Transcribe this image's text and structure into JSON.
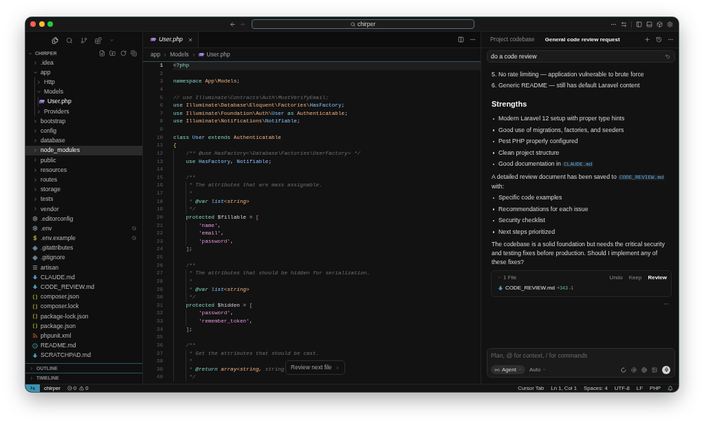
{
  "title_bar": {
    "nav": [
      {
        "kind": "back",
        "disabled": false
      },
      {
        "kind": "forward",
        "disabled": true
      }
    ],
    "command_center": "chirper"
  },
  "activity_bar": [
    {
      "kind": "explorer",
      "selected": true
    },
    {
      "kind": "search",
      "selected": false
    },
    {
      "kind": "source_control",
      "selected": false
    },
    {
      "kind": "extensions",
      "selected": false
    }
  ],
  "explorer": {
    "title": "CHIRPER",
    "expanded": true,
    "tree": [
      {
        "name": ".idea",
        "kind": "folder",
        "expanded": false,
        "selected": false,
        "active": false,
        "ignored": false
      },
      {
        "name": "app",
        "kind": "folder",
        "expanded": true,
        "selected": false,
        "active": false,
        "ignored": false,
        "children": [
          {
            "name": "Http",
            "kind": "folder",
            "expanded": false,
            "selected": false,
            "active": false,
            "ignored": false
          },
          {
            "name": "Models",
            "kind": "folder",
            "expanded": true,
            "selected": false,
            "active": false,
            "ignored": false,
            "children": [
              {
                "name": "User.php",
                "kind": "php",
                "selected": false,
                "active": true,
                "ignored": false
              }
            ]
          },
          {
            "name": "Providers",
            "kind": "folder",
            "expanded": false,
            "selected": false,
            "active": false,
            "ignored": false
          }
        ]
      },
      {
        "name": "bootstrap",
        "kind": "folder",
        "expanded": false,
        "selected": false,
        "active": false,
        "ignored": false
      },
      {
        "name": "config",
        "kind": "folder",
        "expanded": false,
        "selected": false,
        "active": false,
        "ignored": false
      },
      {
        "name": "database",
        "kind": "folder",
        "expanded": false,
        "selected": false,
        "active": false,
        "ignored": false
      },
      {
        "name": "node_modules",
        "kind": "folder",
        "expanded": false,
        "selected": true,
        "active": false,
        "ignored": false
      },
      {
        "name": "public",
        "kind": "folder",
        "expanded": false,
        "selected": false,
        "active": false,
        "ignored": false
      },
      {
        "name": "resources",
        "kind": "folder",
        "expanded": false,
        "selected": false,
        "active": false,
        "ignored": false
      },
      {
        "name": "routes",
        "kind": "folder",
        "expanded": false,
        "selected": false,
        "active": false,
        "ignored": false
      },
      {
        "name": "storage",
        "kind": "folder",
        "expanded": false,
        "selected": false,
        "active": false,
        "ignored": false
      },
      {
        "name": "tests",
        "kind": "folder",
        "expanded": false,
        "selected": false,
        "active": false,
        "ignored": false
      },
      {
        "name": "vendor",
        "kind": "folder",
        "expanded": false,
        "selected": false,
        "active": false,
        "ignored": false
      },
      {
        "name": ".editorconfig",
        "kind": "settings",
        "selected": false,
        "active": false,
        "ignored": false
      },
      {
        "name": ".env",
        "kind": "settings",
        "selected": false,
        "active": false,
        "ignored": true
      },
      {
        "name": ".env.example",
        "kind": "env",
        "selected": false,
        "active": false,
        "ignored": true
      },
      {
        "name": ".gitattributes",
        "kind": "git",
        "selected": false,
        "active": false,
        "ignored": false
      },
      {
        "name": ".gitignore",
        "kind": "git",
        "selected": false,
        "active": false,
        "ignored": false
      },
      {
        "name": "artisan",
        "kind": "text",
        "selected": false,
        "active": false,
        "ignored": false
      },
      {
        "name": "CLAUDE.md",
        "kind": "markdown",
        "selected": false,
        "active": false,
        "ignored": false
      },
      {
        "name": "CODE_REVIEW.md",
        "kind": "markdown",
        "selected": false,
        "active": false,
        "ignored": false
      },
      {
        "name": "composer.json",
        "kind": "json",
        "selected": false,
        "active": false,
        "ignored": false
      },
      {
        "name": "composer.lock",
        "kind": "json",
        "selected": false,
        "active": false,
        "ignored": false
      },
      {
        "name": "package-lock.json",
        "kind": "json",
        "selected": false,
        "active": false,
        "ignored": false
      },
      {
        "name": "package.json",
        "kind": "json",
        "selected": false,
        "active": false,
        "ignored": false
      },
      {
        "name": "phpunit.xml",
        "kind": "xml",
        "selected": false,
        "active": false,
        "ignored": false
      },
      {
        "name": "README.md",
        "kind": "info",
        "selected": false,
        "active": false,
        "ignored": false
      },
      {
        "name": "SCRATCHPAD.md",
        "kind": "markdown",
        "selected": false,
        "active": false,
        "ignored": false
      }
    ]
  },
  "sidebar_sections": [
    {
      "title": "OUTLINE",
      "expanded": false
    },
    {
      "title": "TIMELINE",
      "expanded": false
    }
  ],
  "editor": {
    "tabs": [
      {
        "label": "User.php",
        "kind": "php",
        "preview": true,
        "selected": true
      }
    ],
    "breadcrumbs": [
      {
        "label": "app",
        "kind": "folder"
      },
      {
        "label": "Models",
        "kind": "folder"
      },
      {
        "label": "User.php",
        "kind": "php"
      }
    ],
    "lines": [
      {
        "number": "1",
        "current": true,
        "tokens": [
          {
            "kind": "tag",
            "text": "<?php"
          }
        ]
      },
      {
        "number": "2",
        "current": false
      },
      {
        "number": "3",
        "current": false,
        "tokens": [
          {
            "kind": "keyword",
            "text": "namespace "
          },
          {
            "kind": "namespace",
            "text": "App\\Models"
          },
          {
            "kind": "plain",
            "text": ";"
          }
        ]
      },
      {
        "number": "4",
        "current": false
      },
      {
        "number": "5",
        "current": false,
        "tokens": [
          {
            "kind": "comment",
            "text": "// use Illuminate\\Contracts\\Auth\\MustVerifyEmail;"
          }
        ]
      },
      {
        "number": "6",
        "current": false,
        "tokens": [
          {
            "kind": "keyword",
            "text": "use "
          },
          {
            "kind": "namespace",
            "text": "Illuminate\\Database\\Eloquent\\Factories\\"
          },
          {
            "kind": "type",
            "text": "HasFactory"
          },
          {
            "kind": "plain",
            "text": ";"
          }
        ]
      },
      {
        "number": "7",
        "current": false,
        "tokens": [
          {
            "kind": "keyword",
            "text": "use "
          },
          {
            "kind": "namespace",
            "text": "Illuminate\\Foundation\\Auth\\"
          },
          {
            "kind": "type",
            "text": "User"
          },
          {
            "kind": "keyword",
            "text": " as "
          },
          {
            "kind": "namespace",
            "text": "Authenticatable"
          },
          {
            "kind": "plain",
            "text": ";"
          }
        ]
      },
      {
        "number": "8",
        "current": false,
        "tokens": [
          {
            "kind": "keyword",
            "text": "use "
          },
          {
            "kind": "namespace",
            "text": "Illuminate\\Notifications\\"
          },
          {
            "kind": "type",
            "text": "Notifiable"
          },
          {
            "kind": "plain",
            "text": ";"
          }
        ]
      },
      {
        "number": "9",
        "current": false
      },
      {
        "number": "10",
        "current": false,
        "tokens": [
          {
            "kind": "keyword",
            "text": "class "
          },
          {
            "kind": "type",
            "text": "User"
          },
          {
            "kind": "keyword",
            "text": " extends "
          },
          {
            "kind": "namespace",
            "text": "Authenticatable"
          }
        ]
      },
      {
        "number": "11",
        "current": false,
        "tokens": [
          {
            "kind": "brace",
            "text": "{"
          }
        ]
      },
      {
        "number": "12",
        "current": false,
        "tokens": [
          {
            "kind": "comment",
            "text": "    /** @use HasFactory<\\Database\\Factories\\UserFactory> */"
          }
        ]
      },
      {
        "number": "13",
        "current": false,
        "tokens": [
          {
            "kind": "keyword",
            "text": "    use "
          },
          {
            "kind": "type",
            "text": "HasFactory"
          },
          {
            "kind": "plain",
            "text": ", "
          },
          {
            "kind": "type",
            "text": "Notifiable"
          },
          {
            "kind": "plain",
            "text": ";"
          }
        ]
      },
      {
        "number": "14",
        "current": false
      },
      {
        "number": "15",
        "current": false,
        "tokens": [
          {
            "kind": "comment",
            "text": "    /**"
          }
        ]
      },
      {
        "number": "16",
        "current": false,
        "tokens": [
          {
            "kind": "comment",
            "text": "     * The attributes that are mass assignable."
          }
        ]
      },
      {
        "number": "17",
        "current": false,
        "tokens": [
          {
            "kind": "comment",
            "text": "     *"
          }
        ]
      },
      {
        "number": "18",
        "current": false,
        "tokens": [
          {
            "kind": "comment",
            "text": "     * "
          },
          {
            "kind": "doctag",
            "text": "@var"
          },
          {
            "kind": "doctype",
            "text": " list"
          },
          {
            "kind": "docgeneric",
            "text": "<string>"
          }
        ]
      },
      {
        "number": "19",
        "current": false,
        "tokens": [
          {
            "kind": "comment",
            "text": "     */"
          }
        ]
      },
      {
        "number": "20",
        "current": false,
        "tokens": [
          {
            "kind": "keyword",
            "text": "    protected "
          },
          {
            "kind": "variable",
            "text": "$fillable = "
          },
          {
            "kind": "bracket",
            "text": "["
          }
        ]
      },
      {
        "number": "21",
        "current": false,
        "tokens": [
          {
            "kind": "string",
            "text": "        'name'"
          },
          {
            "kind": "plain",
            "text": ","
          }
        ]
      },
      {
        "number": "22",
        "current": false,
        "tokens": [
          {
            "kind": "string",
            "text": "        'email'"
          },
          {
            "kind": "plain",
            "text": ","
          }
        ]
      },
      {
        "number": "23",
        "current": false,
        "tokens": [
          {
            "kind": "string",
            "text": "        'password'"
          },
          {
            "kind": "plain",
            "text": ","
          }
        ]
      },
      {
        "number": "24",
        "current": false,
        "tokens": [
          {
            "kind": "bracket",
            "text": "    ]"
          },
          {
            "kind": "plain",
            "text": ";"
          }
        ]
      },
      {
        "number": "25",
        "current": false
      },
      {
        "number": "26",
        "current": false,
        "tokens": [
          {
            "kind": "comment",
            "text": "    /**"
          }
        ]
      },
      {
        "number": "27",
        "current": false,
        "tokens": [
          {
            "kind": "comment",
            "text": "     * The attributes that should be hidden for serialization."
          }
        ]
      },
      {
        "number": "28",
        "current": false,
        "tokens": [
          {
            "kind": "comment",
            "text": "     *"
          }
        ]
      },
      {
        "number": "29",
        "current": false,
        "tokens": [
          {
            "kind": "comment",
            "text": "     * "
          },
          {
            "kind": "doctag",
            "text": "@var"
          },
          {
            "kind": "doctype",
            "text": " list"
          },
          {
            "kind": "docgeneric",
            "text": "<string>"
          }
        ]
      },
      {
        "number": "30",
        "current": false,
        "tokens": [
          {
            "kind": "comment",
            "text": "     */"
          }
        ]
      },
      {
        "number": "31",
        "current": false,
        "tokens": [
          {
            "kind": "keyword",
            "text": "    protected "
          },
          {
            "kind": "variable",
            "text": "$hidden = "
          },
          {
            "kind": "bracket",
            "text": "["
          }
        ]
      },
      {
        "number": "32",
        "current": false,
        "tokens": [
          {
            "kind": "string",
            "text": "        'password'"
          },
          {
            "kind": "plain",
            "text": ","
          }
        ]
      },
      {
        "number": "33",
        "current": false,
        "tokens": [
          {
            "kind": "string",
            "text": "        'remember_token'"
          },
          {
            "kind": "plain",
            "text": ","
          }
        ]
      },
      {
        "number": "34",
        "current": false,
        "tokens": [
          {
            "kind": "bracket",
            "text": "    ]"
          },
          {
            "kind": "plain",
            "text": ";"
          }
        ]
      },
      {
        "number": "35",
        "current": false
      },
      {
        "number": "36",
        "current": false,
        "tokens": [
          {
            "kind": "comment",
            "text": "    /**"
          }
        ]
      },
      {
        "number": "37",
        "current": false,
        "tokens": [
          {
            "kind": "comment",
            "text": "     * Get the attributes that should be cast."
          }
        ]
      },
      {
        "number": "38",
        "current": false,
        "tokens": [
          {
            "kind": "comment",
            "text": "     *"
          }
        ]
      },
      {
        "number": "39",
        "current": false,
        "tokens": [
          {
            "kind": "comment",
            "text": "     * "
          },
          {
            "kind": "doctag",
            "text": "@return"
          },
          {
            "kind": "docgeneric",
            "text": " array<string,"
          },
          {
            "kind": "comment",
            "text": " string"
          }
        ]
      },
      {
        "number": "40",
        "current": false,
        "tokens": [
          {
            "kind": "comment",
            "text": "     */"
          }
        ]
      }
    ],
    "overlay_button": {
      "label": "Review next file"
    }
  },
  "chat": {
    "tabs": [
      {
        "label": "Project codebase",
        "selected": false
      },
      {
        "label": "General code review request",
        "selected": true
      }
    ],
    "prompt": "do a code review",
    "blocks": [
      {
        "kind": "numbered",
        "marker": "5.",
        "text": "No rate limiting — application vulnerable to brute force"
      },
      {
        "kind": "numbered",
        "marker": "6.",
        "text": "Generic README — still has default Laravel content"
      },
      {
        "kind": "heading",
        "text": "Strengths"
      },
      {
        "kind": "bullet",
        "text": "Modern Laravel 12 setup with proper type hints"
      },
      {
        "kind": "bullet",
        "text": "Good use of migrations, factories, and seeders"
      },
      {
        "kind": "bullet",
        "text": "Pest PHP properly configured"
      },
      {
        "kind": "bullet",
        "text": "Clean project structure"
      },
      {
        "kind": "bullet",
        "text": "Good documentation in",
        "code": "CLAUDE.md"
      },
      {
        "kind": "paragraph",
        "text": "A detailed review document has been saved to",
        "code": "CODE_REVIEW.md",
        "after": "with:"
      },
      {
        "kind": "bullet",
        "text": "Specific code examples"
      },
      {
        "kind": "bullet",
        "text": "Recommendations for each issue"
      },
      {
        "kind": "bullet",
        "text": "Security checklist"
      },
      {
        "kind": "bullet",
        "text": "Next steps prioritized"
      },
      {
        "kind": "paragraph",
        "text": "The codebase is a solid foundation but needs the critical security and testing fixes before production. Should I implement any of these fixes?"
      }
    ],
    "changes": {
      "expanded": true,
      "summary": "1 File",
      "actions": [
        {
          "label": "Undo",
          "primary": false
        },
        {
          "label": "Keep",
          "primary": false
        },
        {
          "label": "Review",
          "primary": true
        }
      ],
      "files": [
        {
          "name": "CODE_REVIEW.md",
          "kind": "markdown",
          "added": "+343",
          "removed": "-1"
        }
      ]
    },
    "composer": {
      "placeholder": "Plan, @ for context, / for commands",
      "mode": "Agent",
      "model": "Auto"
    }
  },
  "status_bar": {
    "workspace": "chirper",
    "errors": "0",
    "warnings": "0",
    "items": [
      "Cursor Tab",
      "Ln 1, Col 1",
      "Spaces: 4",
      "UTF-8",
      "LF",
      "PHP"
    ]
  }
}
